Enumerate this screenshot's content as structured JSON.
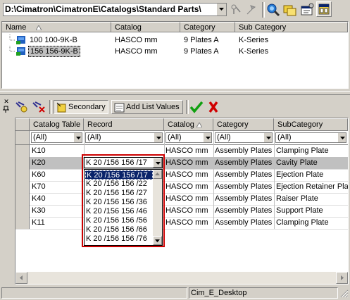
{
  "path_combo": {
    "value": "D:\\Cimatron\\CimatronE\\Catalogs\\Standard Parts\\"
  },
  "parts_list": {
    "columns": [
      "Name",
      "Catalog",
      "Category",
      "Sub Category"
    ],
    "rows": [
      {
        "name": "100 100-9K-B",
        "catalog": "HASCO mm",
        "category": "9 Plates A",
        "subcategory": "K-Series"
      },
      {
        "name": "156 156-9K-B",
        "catalog": "HASCO mm",
        "category": "9 Plates A",
        "subcategory": "K-Series"
      }
    ]
  },
  "toolbar": {
    "secondary_label": "Secondary",
    "add_list_values_label": "Add List Values"
  },
  "grid": {
    "columns": [
      "Catalog Table",
      "Record",
      "Catalog",
      "Category",
      "SubCategory"
    ],
    "filter": [
      "(All)",
      "(All)",
      "(All)",
      "(All)",
      "(All)"
    ],
    "rows": [
      {
        "table": "K10",
        "record": "",
        "catalog": "HASCO mm",
        "category": "Assembly Plates",
        "subcategory": "Clamping Plate"
      },
      {
        "table": "K20",
        "record": "K 20 /156 156 /17",
        "catalog": "HASCO mm",
        "category": "Assembly Plates",
        "subcategory": "Cavity Plate"
      },
      {
        "table": "K60",
        "record": "",
        "catalog": "HASCO mm",
        "category": "Assembly Plates",
        "subcategory": "Ejection Plate"
      },
      {
        "table": "K70",
        "record": "",
        "catalog": "HASCO mm",
        "category": "Assembly Plates",
        "subcategory": "Ejection Retainer Plate"
      },
      {
        "table": "K40",
        "record": "",
        "catalog": "HASCO mm",
        "category": "Assembly Plates",
        "subcategory": "Raiser Plate"
      },
      {
        "table": "K30",
        "record": "",
        "catalog": "HASCO mm",
        "category": "Assembly Plates",
        "subcategory": "Support Plate"
      },
      {
        "table": "K11",
        "record": "",
        "catalog": "HASCO mm",
        "category": "Assembly Plates",
        "subcategory": "Clamping Plate"
      }
    ]
  },
  "record_dropdown": {
    "options": [
      "K 20 /156 156 /17",
      "K 20 /156 156 /22",
      "K 20 /156 156 /27",
      "K 20 /156 156 /36",
      "K 20 /156 156 /46",
      "K 20 /156 156 /56",
      "K 20 /156 156 /66",
      "K 20 /156 156 /76"
    ],
    "selected_index": 0
  },
  "status_bar": {
    "text": "Cim_E_Desktop"
  },
  "colors": {
    "selection": "#0a246a",
    "highlight_border": "#cc0000",
    "face": "#d4d0c8"
  }
}
